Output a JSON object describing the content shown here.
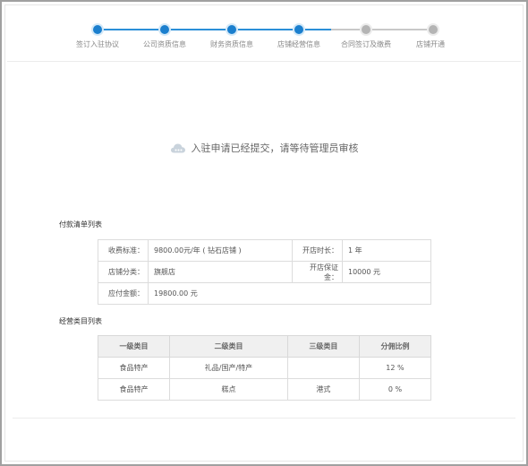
{
  "steps": [
    {
      "label": "签订入驻协议",
      "status": "done"
    },
    {
      "label": "公司资质信息",
      "status": "done"
    },
    {
      "label": "财务资质信息",
      "status": "done"
    },
    {
      "label": "店铺经营信息",
      "status": "done"
    },
    {
      "label": "合同签订及缴费",
      "status": "todo"
    },
    {
      "label": "店铺开通",
      "status": "todo"
    }
  ],
  "message": {
    "icon": "cloud-icon",
    "text": "入驻申请已经提交，请等待管理员审核"
  },
  "payment": {
    "title": "付款清单列表",
    "fee_label": "收费标准：",
    "fee_value": "9800.00元/年 ( 钻石店铺 )",
    "duration_label": "开店时长：",
    "duration_value": "1 年",
    "category_label": "店铺分类：",
    "category_value": "旗舰店",
    "deposit_label": "开店保证金：",
    "deposit_value": "10000 元",
    "total_label": "应付金额：",
    "total_value": "19800.00 元"
  },
  "categories": {
    "title": "经营类目列表",
    "headers": [
      "一级类目",
      "二级类目",
      "三级类目",
      "分佣比例"
    ],
    "rows": [
      [
        "食品特产",
        "礼品/国产/特产",
        "",
        "12 %"
      ],
      [
        "食品特产",
        "糕点",
        "港式",
        "0 %"
      ]
    ]
  },
  "colors": {
    "accent": "#1b7fce",
    "inactive": "#b4b4b4"
  }
}
